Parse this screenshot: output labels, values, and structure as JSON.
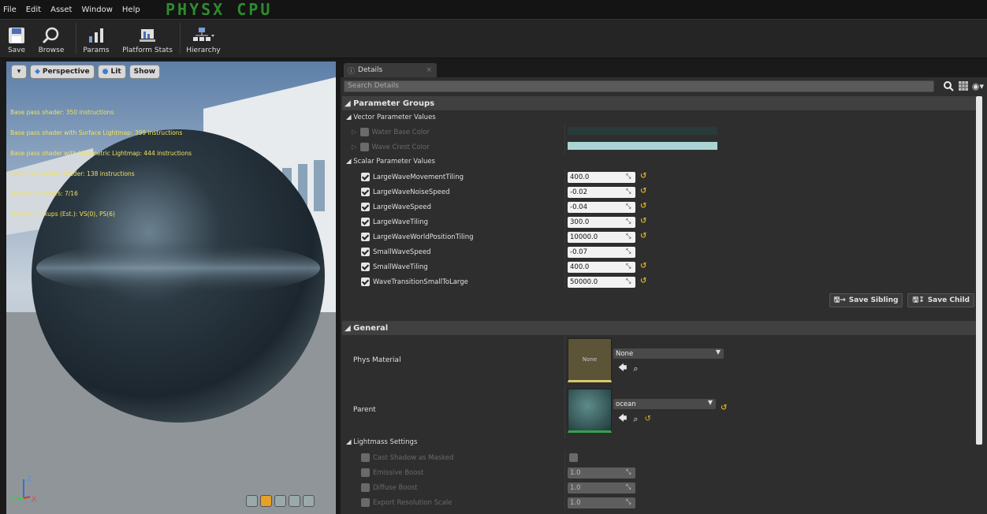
{
  "menu": [
    "File",
    "Edit",
    "Asset",
    "Window",
    "Help"
  ],
  "brand": "PHYSX CPU",
  "toolbar": {
    "save": "Save",
    "browse": "Browse",
    "params": "Params",
    "platform_stats": "Platform Stats",
    "hierarchy": "Hierarchy"
  },
  "viewport": {
    "perspective": "Perspective",
    "lit": "Lit",
    "show": "Show",
    "stats": [
      "Base pass shader: 350 instructions",
      "Base pass shader with Surface Lightmap: 399 instructions",
      "Base pass shader with Volumetric Lightmap: 444 instructions",
      "Base pass vertex shader: 138 instructions",
      "Texture samplers: 7/16",
      "Texture Lookups (Est.): VS(0), PS(6)"
    ],
    "axis_z": "Z",
    "axis_y": "Y",
    "axis_x": "X"
  },
  "details": {
    "tab": "Details",
    "search_placeholder": "Search Details",
    "parameter_groups": "Parameter Groups",
    "vector_params": "Vector Parameter Values",
    "water_base_color": "Water Base Color",
    "water_base_color_hex": "#2a3a3a",
    "wave_crest_color": "Wave Crest Color",
    "wave_crest_color_hex": "#a9d4d4",
    "scalar_params": "Scalar Parameter Values",
    "scalars": [
      {
        "label": "LargeWaveMovementTiling",
        "value": "400.0"
      },
      {
        "label": "LargeWaveNoiseSpeed",
        "value": "-0.02"
      },
      {
        "label": "LargeWaveSpeed",
        "value": "-0.04"
      },
      {
        "label": "LargeWaveTiling",
        "value": "300.0"
      },
      {
        "label": "LargeWaveWorldPositionTiling",
        "value": "10000.0"
      },
      {
        "label": "SmallWaveSpeed",
        "value": "-0.07"
      },
      {
        "label": "SmallWaveTiling",
        "value": "400.0"
      },
      {
        "label": "WaveTransitionSmallToLarge",
        "value": "50000.0"
      }
    ],
    "save_sibling": "Save Sibling",
    "save_child": "Save Child",
    "general": "General",
    "phys_material": "Phys Material",
    "phys_thumb": "None",
    "phys_value": "None",
    "parent": "Parent",
    "parent_value": "ocean",
    "lightmass": "Lightmass Settings",
    "cast_shadow": "Cast Shadow as Masked",
    "emissive_boost": "Emissive Boost",
    "emissive_value": "1.0",
    "diffuse_boost": "Diffuse Boost",
    "diffuse_value": "1.0",
    "export_res": "Export Resolution Scale",
    "export_value": "1.0"
  }
}
